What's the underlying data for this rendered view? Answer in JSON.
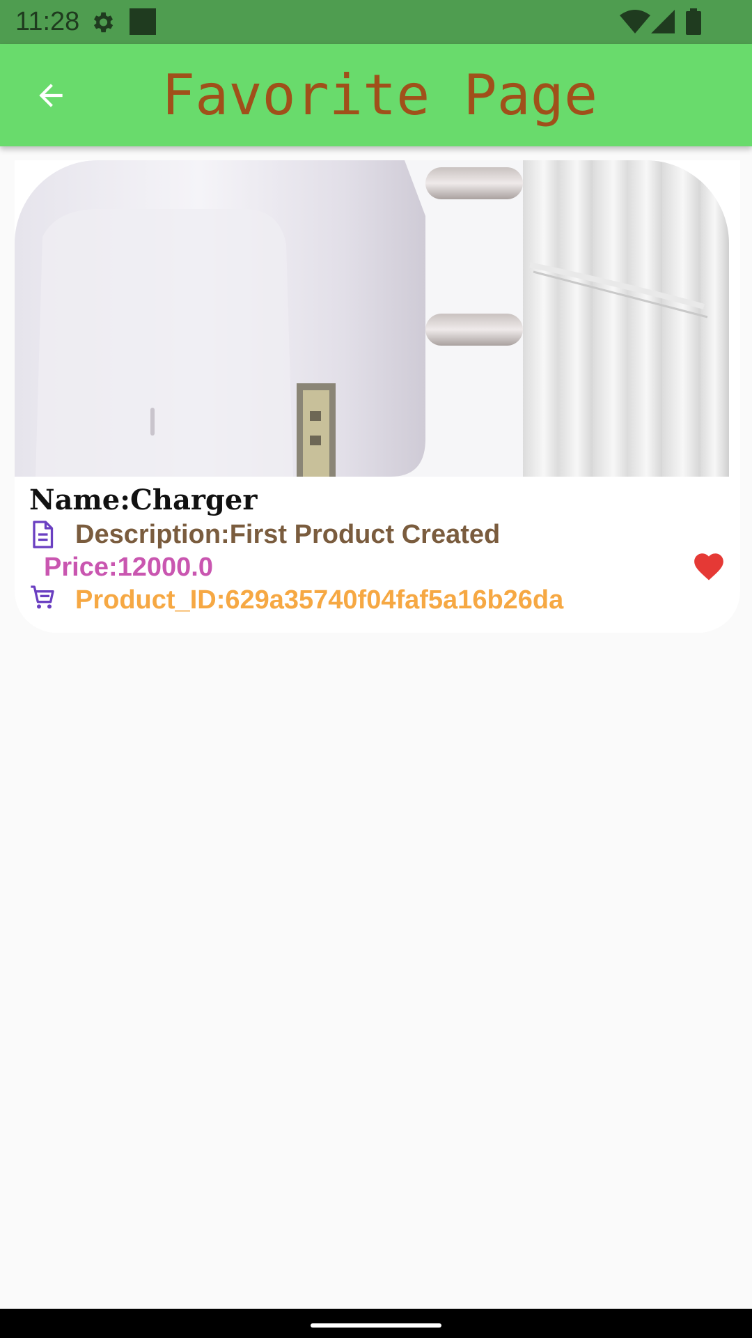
{
  "status_bar": {
    "time": "11:28",
    "icons": [
      "gear-icon",
      "notification-square-icon",
      "wifi-icon",
      "signal-icon",
      "battery-icon"
    ],
    "background": "#4f9d50"
  },
  "app_bar": {
    "title": "Favorite Page",
    "back_icon": "arrow-left-icon",
    "background": "#69db6c",
    "title_color": "#a0501a"
  },
  "product": {
    "image_alt": "charger-image",
    "name": "Name:Charger",
    "description": "Description:First Product Created",
    "price": "Price:12000.0",
    "product_id": "Product_ID:629a35740f04faf5a16b26da",
    "description_icon": "document-icon",
    "cart_icon": "cart-icon",
    "favorite_icon": "heart-icon",
    "favorited": true,
    "colors": {
      "description": "#7a5c3e",
      "price": "#c956b0",
      "product_id": "#f6a843",
      "heart": "#e53935",
      "icon": "#6a3fc1"
    }
  }
}
